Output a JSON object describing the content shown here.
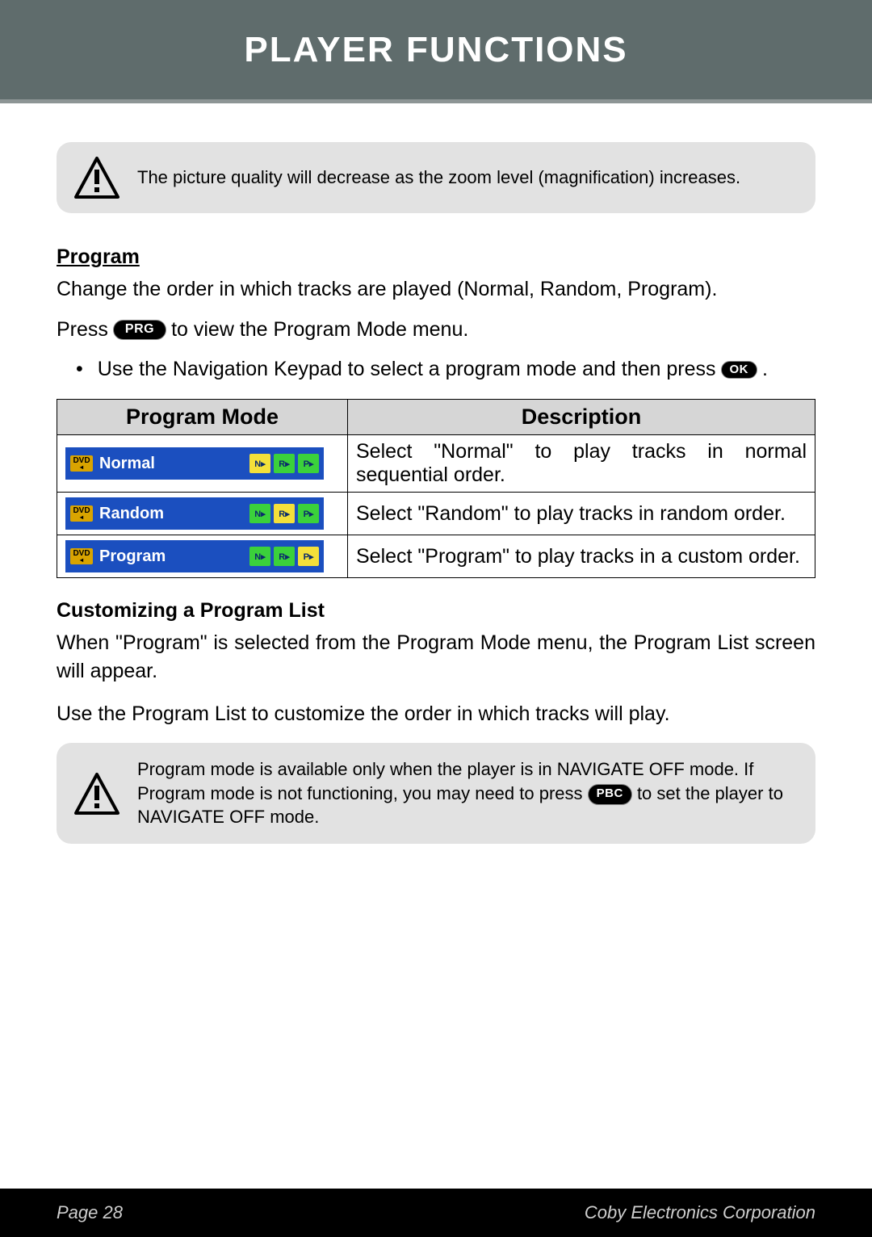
{
  "header": {
    "title": "Player Functions"
  },
  "callout1": "The picture quality will decrease as the zoom level (magnification) increases.",
  "program": {
    "heading": "Program",
    "intro": "Change the order in which tracks are played (Normal, Random, Program).",
    "press_before": "Press",
    "prg_label": "PRG",
    "press_after": "to view the Program Mode menu.",
    "bullet_before": "Use the Navigation Keypad to select a program mode and then press",
    "ok_label": "OK",
    "bullet_after": "."
  },
  "table": {
    "col1": "Program Mode",
    "col2": "Description",
    "dvd": "DVD",
    "chips": {
      "n": "N▸",
      "r": "R▸",
      "p": "P▸"
    },
    "rows": [
      {
        "mode": "Normal",
        "highlight": "n",
        "desc": "Select \"Normal\" to play tracks in normal sequential order."
      },
      {
        "mode": "Random",
        "highlight": "r",
        "desc": "Select \"Random\" to play tracks in random order."
      },
      {
        "mode": "Program",
        "highlight": "p",
        "desc": "Select \"Program\" to play tracks in a custom order."
      }
    ]
  },
  "customize": {
    "heading": "Customizing a Program List",
    "p1": "When \"Program\" is selected from the Program Mode menu, the Program List screen will appear.",
    "p2": "Use the Program List to customize the order in which tracks will play."
  },
  "callout2": {
    "line1": "Program mode is available only when the player is in NAVIGATE OFF mode. If Program mode is not functioning, you may need to press",
    "pbc_label": "PBC",
    "line2": "to set the player to NAVIGATE OFF mode."
  },
  "footer": {
    "left": "Page 28",
    "right": "Coby Electronics Corporation"
  }
}
